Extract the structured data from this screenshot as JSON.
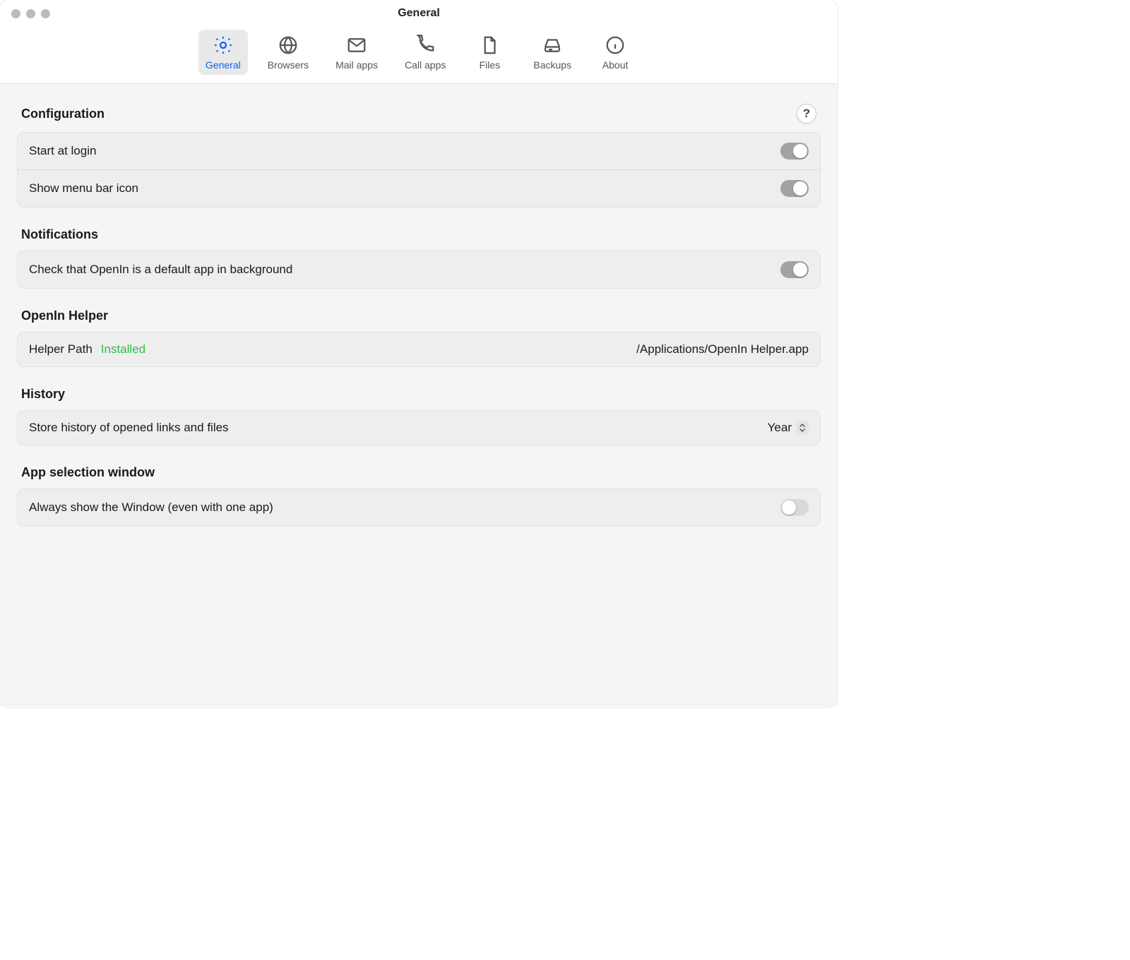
{
  "window": {
    "title": "General"
  },
  "toolbar": {
    "items": [
      {
        "label": "General",
        "icon": "gear-icon",
        "active": true
      },
      {
        "label": "Browsers",
        "icon": "globe-icon",
        "active": false
      },
      {
        "label": "Mail apps",
        "icon": "envelope-icon",
        "active": false
      },
      {
        "label": "Call apps",
        "icon": "phone-icon",
        "active": false
      },
      {
        "label": "Files",
        "icon": "file-icon",
        "active": false
      },
      {
        "label": "Backups",
        "icon": "disk-icon",
        "active": false
      },
      {
        "label": "About",
        "icon": "info-icon",
        "active": false
      }
    ]
  },
  "sections": {
    "configuration": {
      "title": "Configuration",
      "help": "?",
      "rows": {
        "start_login": {
          "label": "Start at login",
          "toggle": true
        },
        "menu_bar": {
          "label": "Show menu bar icon",
          "toggle": true
        }
      }
    },
    "notifications": {
      "title": "Notifications",
      "rows": {
        "default_app": {
          "label": "Check that OpenIn is a default app in background",
          "toggle": true
        }
      }
    },
    "helper": {
      "title": "OpenIn Helper",
      "rows": {
        "helper_path": {
          "label": "Helper Path",
          "badge": "Installed",
          "value": "/Applications/OpenIn Helper.app"
        }
      }
    },
    "history": {
      "title": "History",
      "rows": {
        "store": {
          "label": "Store history of opened links and files",
          "select_value": "Year"
        }
      }
    },
    "app_window": {
      "title": "App selection window",
      "rows": {
        "always_show": {
          "label": "Always show the Window (even with one app)",
          "toggle": false
        }
      }
    }
  }
}
